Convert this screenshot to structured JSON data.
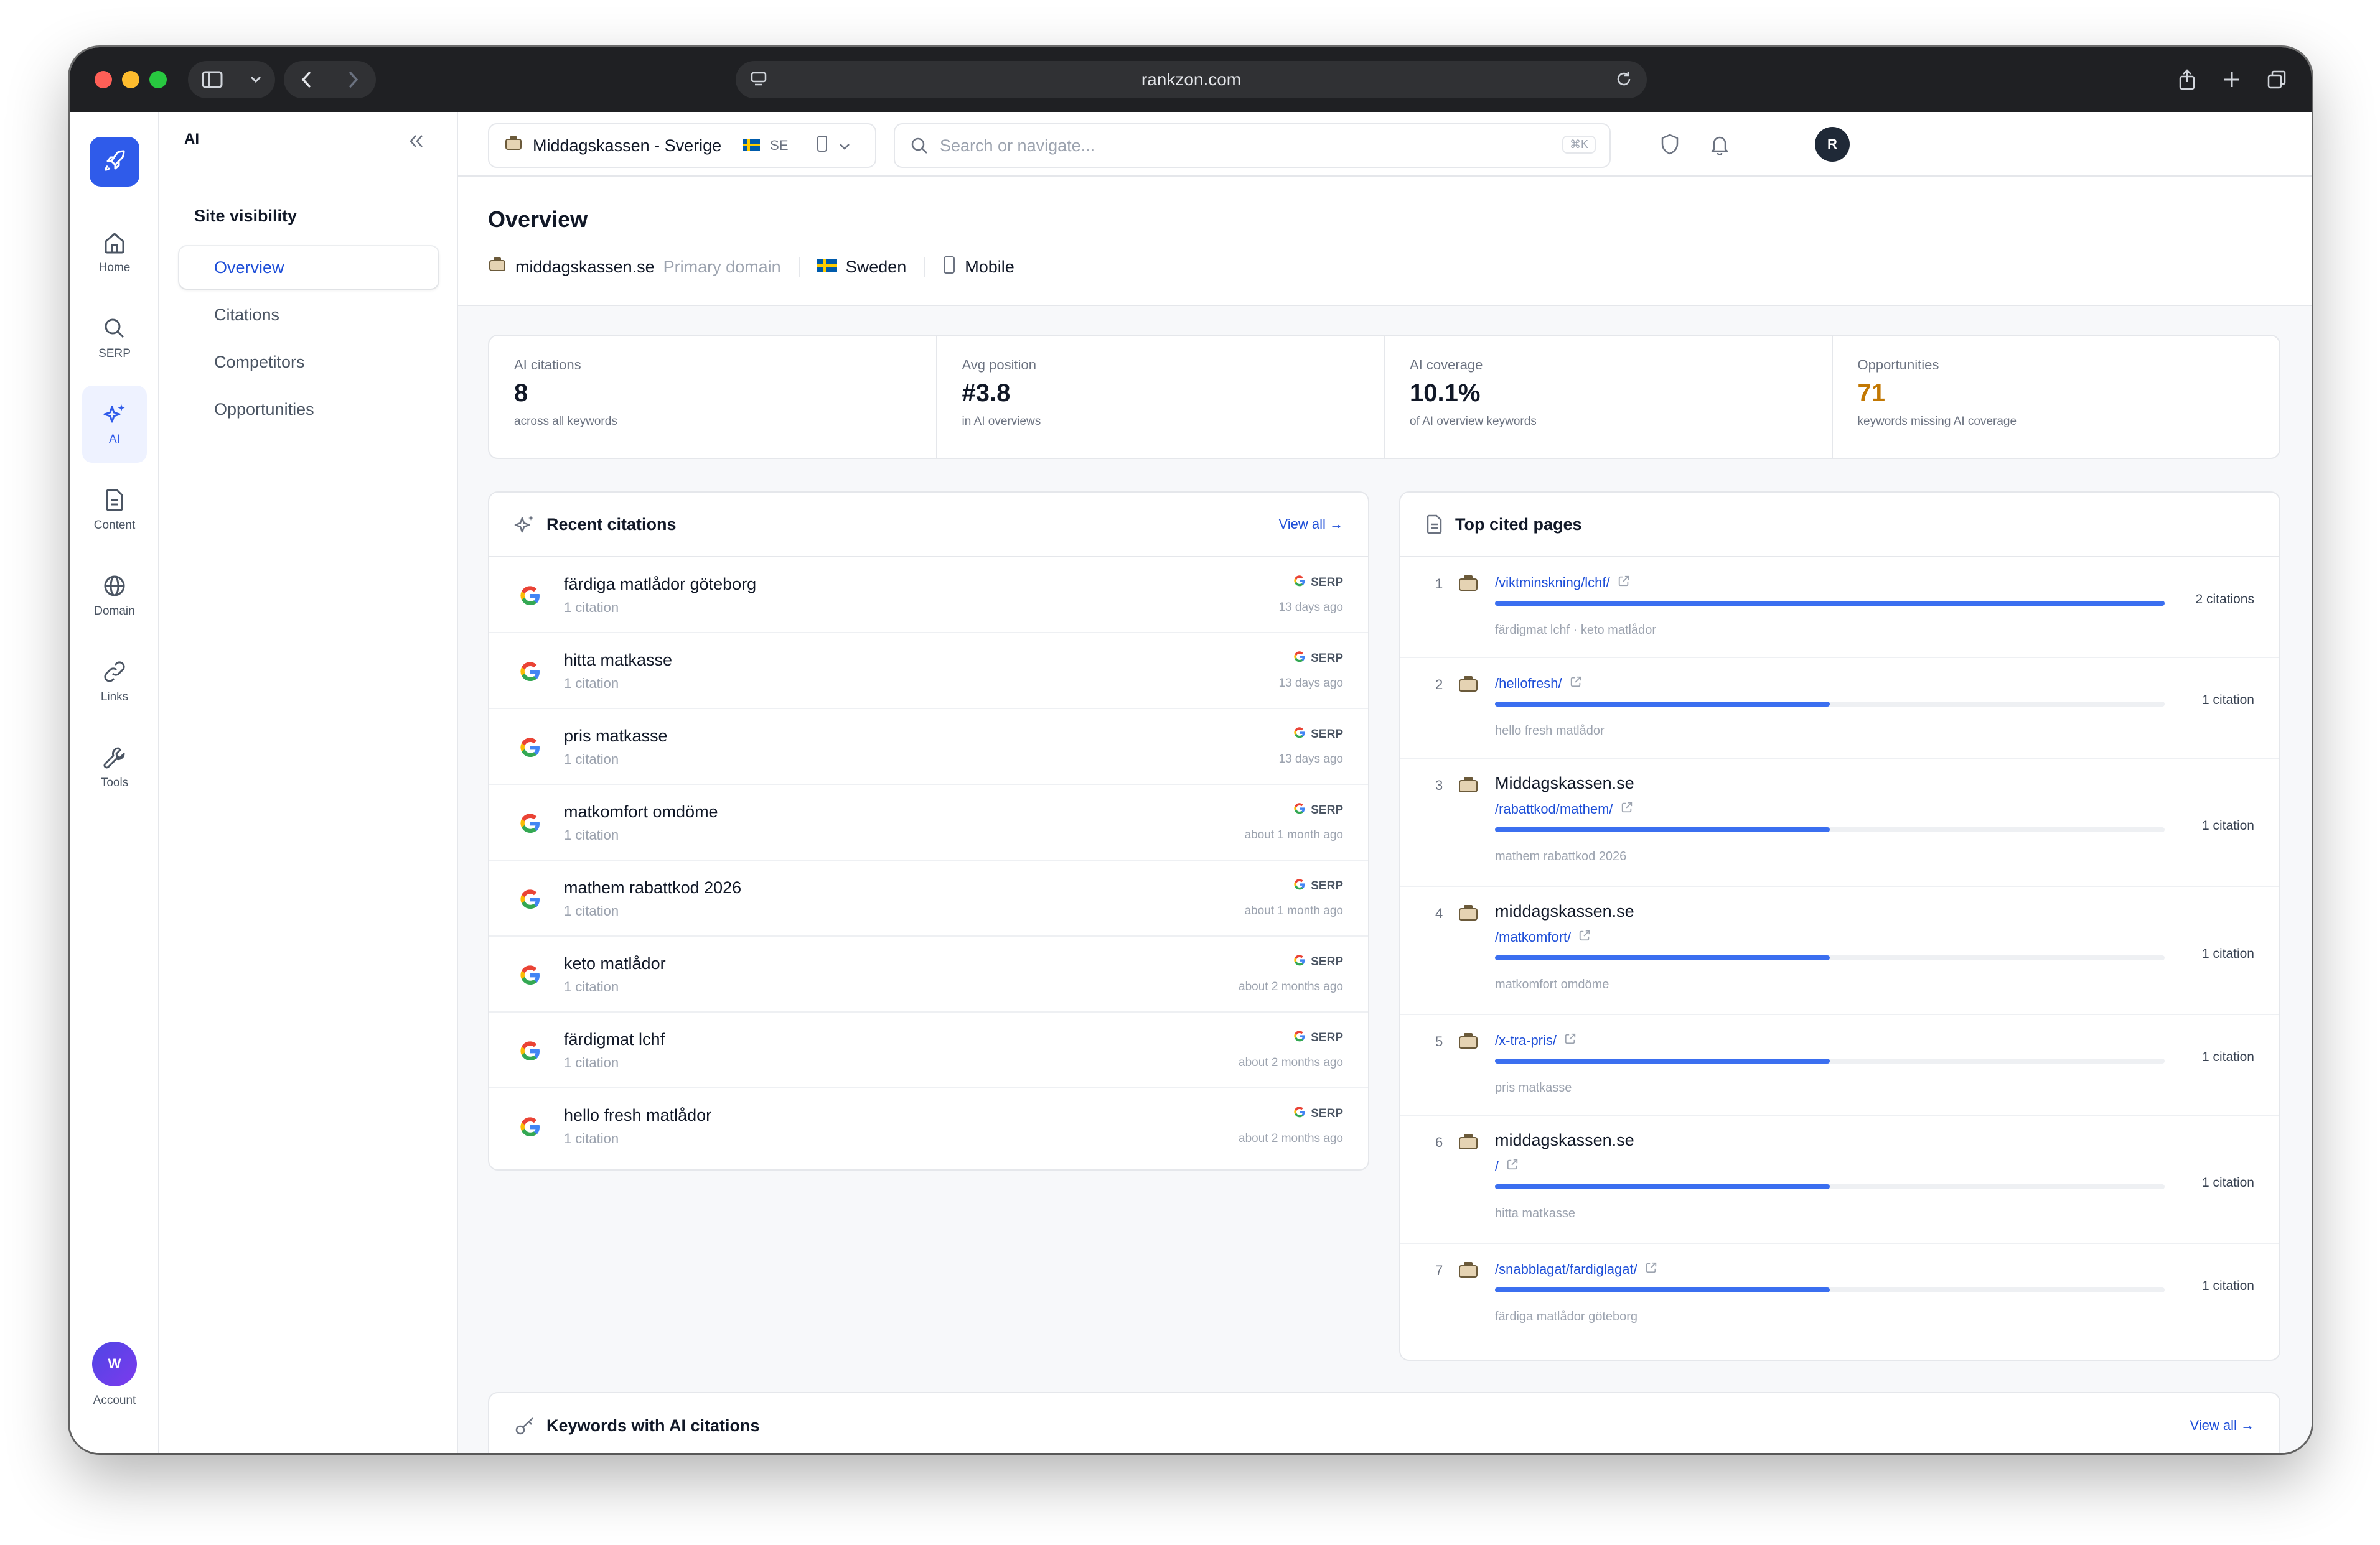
{
  "browser": {
    "address": "rankzon.com"
  },
  "rail": {
    "items": [
      {
        "label": "Home",
        "icon": "home-icon"
      },
      {
        "label": "SERP",
        "icon": "search-icon"
      },
      {
        "label": "AI",
        "icon": "sparkles-icon"
      },
      {
        "label": "Content",
        "icon": "document-icon"
      },
      {
        "label": "Domain",
        "icon": "globe-icon"
      },
      {
        "label": "Links",
        "icon": "link-icon"
      },
      {
        "label": "Tools",
        "icon": "wrench-icon"
      }
    ],
    "account": {
      "initial": "W",
      "label": "Account"
    }
  },
  "subnav": {
    "header": "AI",
    "section_title": "Site visibility",
    "items": [
      "Overview",
      "Citations",
      "Competitors",
      "Opportunities"
    ]
  },
  "topbar": {
    "site_name": "Middagskassen - Sverige",
    "country_code": "SE",
    "search_placeholder": "Search or navigate...",
    "shortcut": "⌘K",
    "user_initial": "R"
  },
  "page": {
    "title": "Overview",
    "domain": "middagskassen.se",
    "domain_tag": "Primary domain",
    "country": "Sweden",
    "device": "Mobile"
  },
  "stats": [
    {
      "label": "AI citations",
      "value": "8",
      "sub": "across all keywords",
      "color": "#111827"
    },
    {
      "label": "Avg position",
      "value": "#3.8",
      "sub": "in AI overviews",
      "color": "#111827"
    },
    {
      "label": "AI coverage",
      "value": "10.1%",
      "sub": "of AI overview keywords",
      "color": "#111827"
    },
    {
      "label": "Opportunities",
      "value": "71",
      "sub": "keywords missing AI coverage",
      "color": "#c27803"
    }
  ],
  "recent_citations": {
    "title": "Recent citations",
    "view_all": "View all →",
    "rows": [
      {
        "keyword": "färdiga matlådor göteborg",
        "count": "1 citation",
        "source": "SERP",
        "ago": "13 days ago"
      },
      {
        "keyword": "hitta matkasse",
        "count": "1 citation",
        "source": "SERP",
        "ago": "13 days ago"
      },
      {
        "keyword": "pris matkasse",
        "count": "1 citation",
        "source": "SERP",
        "ago": "13 days ago"
      },
      {
        "keyword": "matkomfort omdöme",
        "count": "1 citation",
        "source": "SERP",
        "ago": "about 1 month ago"
      },
      {
        "keyword": "mathem rabattkod 2026",
        "count": "1 citation",
        "source": "SERP",
        "ago": "about 1 month ago"
      },
      {
        "keyword": "keto matlådor",
        "count": "1 citation",
        "source": "SERP",
        "ago": "about 2 months ago"
      },
      {
        "keyword": "färdigmat lchf",
        "count": "1 citation",
        "source": "SERP",
        "ago": "about 2 months ago"
      },
      {
        "keyword": "hello fresh matlådor",
        "count": "1 citation",
        "source": "SERP",
        "ago": "about 2 months ago"
      }
    ]
  },
  "top_cited": {
    "title": "Top cited pages",
    "rows": [
      {
        "rank": "1",
        "title": "",
        "path": "/viktminskning/lchf/",
        "count": "2 citations",
        "keywords": "färdigmat lchf · keto matlådor",
        "share": 1.0
      },
      {
        "rank": "2",
        "title": "",
        "path": "/hellofresh/",
        "count": "1 citation",
        "keywords": "hello fresh matlådor",
        "share": 0.5
      },
      {
        "rank": "3",
        "title": "Middagskassen.se",
        "path": "/rabattkod/mathem/",
        "count": "1 citation",
        "keywords": "mathem rabattkod 2026",
        "share": 0.5
      },
      {
        "rank": "4",
        "title": "middagskassen.se",
        "path": "/matkomfort/",
        "count": "1 citation",
        "keywords": "matkomfort omdöme",
        "share": 0.5
      },
      {
        "rank": "5",
        "title": "",
        "path": "/x-tra-pris/",
        "count": "1 citation",
        "keywords": "pris matkasse",
        "share": 0.5
      },
      {
        "rank": "6",
        "title": "middagskassen.se",
        "path": "/",
        "count": "1 citation",
        "keywords": "hitta matkasse",
        "share": 0.5
      },
      {
        "rank": "7",
        "title": "",
        "path": "/snabblagat/fardiglagat/",
        "count": "1 citation",
        "keywords": "färdiga matlådor göteborg",
        "share": 0.5
      }
    ]
  },
  "keywords_card": {
    "title": "Keywords with AI citations",
    "view_all": "View all →"
  },
  "colors": {
    "accent": "#2f5bea",
    "link": "#1d4ed8",
    "bar": "#3b6ff0",
    "warning": "#c27803"
  }
}
